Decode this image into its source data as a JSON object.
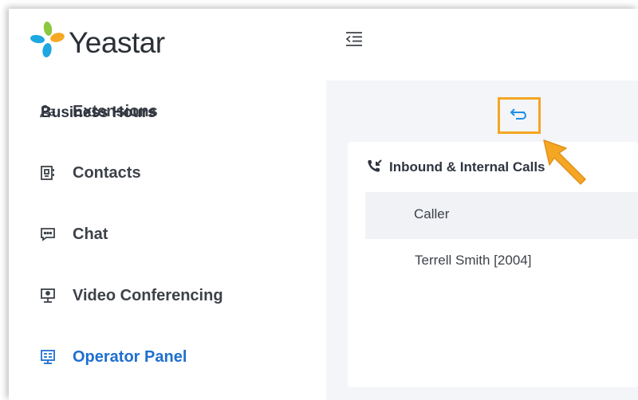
{
  "app": {
    "brand": "Yeastar",
    "accent_color": "#1e6fd0",
    "highlight_color": "#f5a623"
  },
  "sidebar": {
    "items": [
      {
        "label": "Extensions",
        "icon": "user-list-icon",
        "active": false
      },
      {
        "label": "Contacts",
        "icon": "contacts-icon",
        "active": false
      },
      {
        "label": "Chat",
        "icon": "chat-icon",
        "active": false
      },
      {
        "label": "Video Conferencing",
        "icon": "video-conference-icon",
        "active": false
      },
      {
        "label": "Operator Panel",
        "icon": "operator-panel-icon",
        "active": true
      }
    ]
  },
  "topbar": {
    "menu_icon": "collapse-menu-icon"
  },
  "main": {
    "section_title": "Business Hours",
    "switch_icon": "switch-icon",
    "card": {
      "title": "Inbound & Internal Calls",
      "title_icon": "inbound-call-icon",
      "columns": [
        "Caller"
      ],
      "rows": [
        {
          "caller": "Terrell Smith [2004]"
        }
      ]
    }
  }
}
